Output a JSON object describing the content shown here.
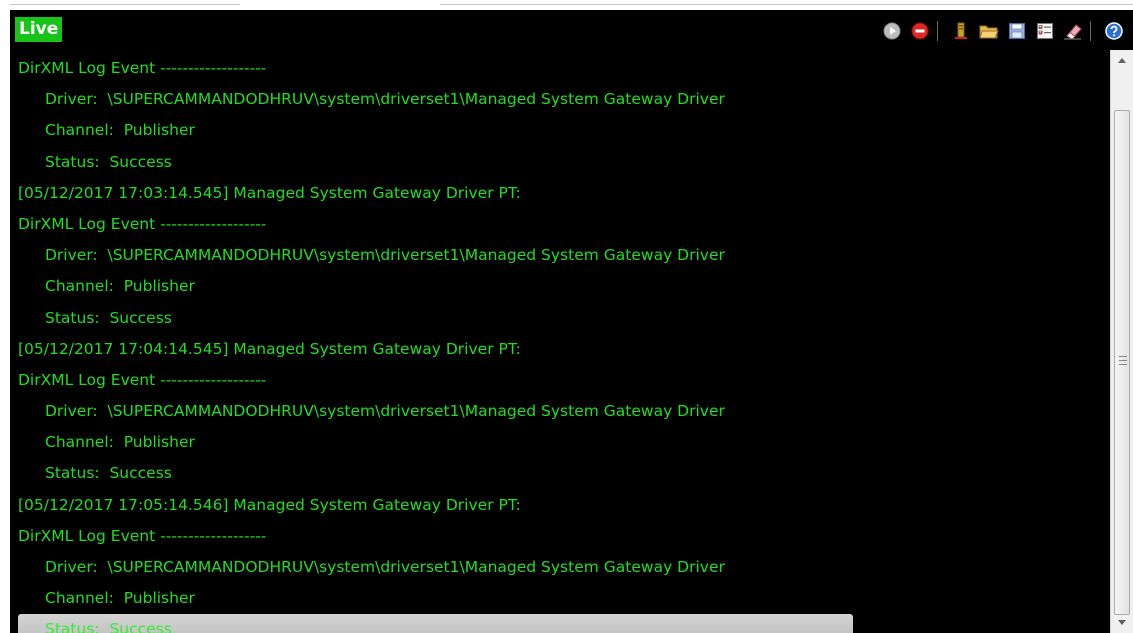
{
  "badge": {
    "label": "Live"
  },
  "toolbar": {
    "icons": [
      "play-icon",
      "stop-icon",
      "trace-icon",
      "open-folder-icon",
      "save-icon",
      "checklist-icon",
      "eraser-icon",
      "help-icon"
    ]
  },
  "log": {
    "lines": [
      {
        "text": "DirXML Log Event -------------------",
        "indent": false
      },
      {
        "text": "Driver:  \\SUPERCAMMANDODHRUV\\system\\driverset1\\Managed System Gateway Driver",
        "indent": true
      },
      {
        "text": "Channel:  Publisher",
        "indent": true
      },
      {
        "text": "Status:  Success",
        "indent": true
      },
      {
        "text": "[05/12/2017 17:03:14.545] Managed System Gateway Driver PT:",
        "indent": false
      },
      {
        "text": "DirXML Log Event -------------------",
        "indent": false
      },
      {
        "text": "Driver:  \\SUPERCAMMANDODHRUV\\system\\driverset1\\Managed System Gateway Driver",
        "indent": true
      },
      {
        "text": "Channel:  Publisher",
        "indent": true
      },
      {
        "text": "Status:  Success",
        "indent": true
      },
      {
        "text": "[05/12/2017 17:04:14.545] Managed System Gateway Driver PT:",
        "indent": false
      },
      {
        "text": "DirXML Log Event -------------------",
        "indent": false
      },
      {
        "text": "Driver:  \\SUPERCAMMANDODHRUV\\system\\driverset1\\Managed System Gateway Driver",
        "indent": true
      },
      {
        "text": "Channel:  Publisher",
        "indent": true
      },
      {
        "text": "Status:  Success",
        "indent": true
      },
      {
        "text": "[05/12/2017 17:05:14.546] Managed System Gateway Driver PT:",
        "indent": false
      },
      {
        "text": "DirXML Log Event -------------------",
        "indent": false
      },
      {
        "text": "Driver:  \\SUPERCAMMANDODHRUV\\system\\driverset1\\Managed System Gateway Driver",
        "indent": true
      },
      {
        "text": "Channel:  Publisher",
        "indent": true
      },
      {
        "text": "Status:  Success",
        "indent": true,
        "selected": true
      }
    ]
  },
  "colors": {
    "background": "#000000",
    "log_text": "#22dd22",
    "badge": "#18c418"
  }
}
